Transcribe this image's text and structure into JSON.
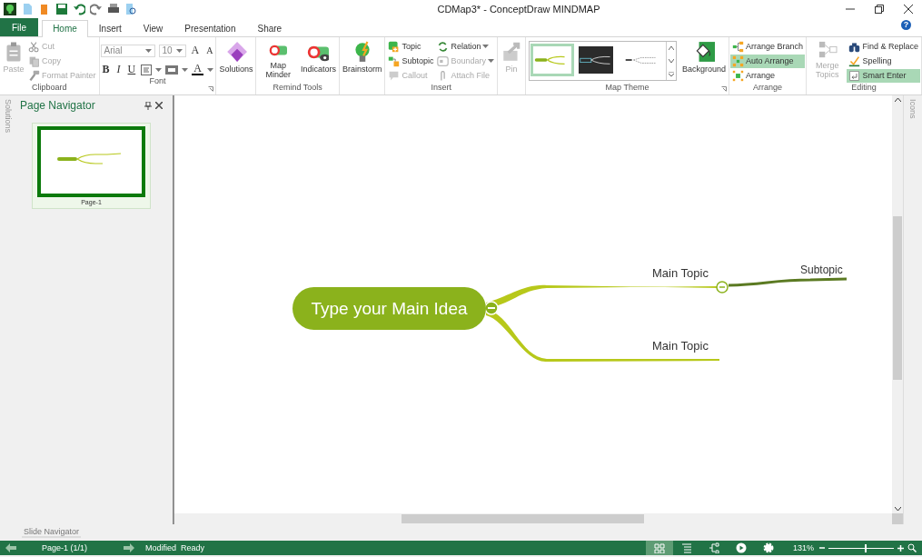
{
  "window": {
    "title": "CDMap3* - ConceptDraw MINDMAP",
    "help": "?"
  },
  "tabs": [
    {
      "label": "File",
      "kind": "file",
      "selected": false
    },
    {
      "label": "Home",
      "kind": "tab",
      "selected": true
    },
    {
      "label": "Insert",
      "kind": "tab",
      "selected": false
    },
    {
      "label": "View",
      "kind": "tab",
      "selected": false
    },
    {
      "label": "Presentation",
      "kind": "tab",
      "selected": false
    },
    {
      "label": "Share",
      "kind": "tab",
      "selected": false
    }
  ],
  "ribbon": {
    "groups": [
      {
        "kind": "buttons",
        "label": "Clipboard",
        "items": [
          {
            "kind": "large",
            "label": "Paste",
            "disabled": true
          },
          {
            "kind": "small",
            "label": "Cut",
            "disabled": true
          },
          {
            "kind": "small",
            "label": "Copy",
            "disabled": true
          },
          {
            "kind": "small",
            "label": "Format Painter",
            "disabled": true
          }
        ]
      },
      {
        "kind": "font",
        "label": "Font",
        "launcher": true,
        "font": {
          "value": "Arial"
        },
        "size": {
          "value": "10"
        },
        "grow": "A",
        "shrink": "A",
        "styles": [
          "B",
          "I",
          "U"
        ],
        "color_letter": "A"
      },
      {
        "kind": "buttons",
        "items": [
          {
            "kind": "large",
            "label": "Solutions",
            "disabled": false
          }
        ]
      },
      {
        "kind": "buttons",
        "label": "Remind Tools",
        "items": [
          {
            "kind": "large",
            "label": "Map Minder",
            "disabled": false
          },
          {
            "kind": "large",
            "label": "Indicators",
            "disabled": false
          }
        ]
      },
      {
        "kind": "buttons",
        "items": [
          {
            "kind": "large",
            "label": "Brainstorm",
            "disabled": false
          }
        ]
      },
      {
        "kind": "buttons",
        "label": "Insert",
        "items": [
          {
            "kind": "small",
            "label": "Topic",
            "disabled": false
          },
          {
            "kind": "small",
            "label": "Subtopic",
            "disabled": false
          },
          {
            "kind": "small",
            "label": "Callout",
            "disabled": true
          },
          {
            "kind": "small",
            "label": "Relation",
            "disabled": false,
            "dropdown": true
          },
          {
            "kind": "small",
            "label": "Boundary",
            "disabled": true,
            "dropdown": true
          },
          {
            "kind": "small",
            "label": "Attach File",
            "disabled": true
          }
        ]
      },
      {
        "kind": "buttons",
        "items": [
          {
            "kind": "large",
            "label": "Pin",
            "disabled": true
          }
        ]
      },
      {
        "kind": "gallery",
        "label": "Map Theme",
        "launcher": true,
        "themes": [
          {
            "kind": "light",
            "selected": true
          },
          {
            "kind": "dark",
            "selected": false
          },
          {
            "kind": "plain",
            "selected": false
          }
        ],
        "items": [
          {
            "kind": "large",
            "label": "Background",
            "disabled": false
          }
        ]
      },
      {
        "kind": "buttons",
        "label": "Arrange",
        "items": [
          {
            "kind": "small",
            "label": "Arrange Branch",
            "disabled": false,
            "on": false
          },
          {
            "kind": "small",
            "label": "Auto Arrange",
            "disabled": false,
            "on": true
          },
          {
            "kind": "small",
            "label": "Arrange",
            "disabled": false,
            "on": false
          }
        ]
      },
      {
        "kind": "buttons",
        "label": "Editing",
        "items": [
          {
            "kind": "large",
            "label": "Merge Topics",
            "disabled": true,
            "on": false
          },
          {
            "kind": "small",
            "label": "Find & Replace",
            "disabled": false,
            "on": false
          },
          {
            "kind": "small",
            "label": "Spelling",
            "disabled": false,
            "on": false
          },
          {
            "kind": "small",
            "label": "Smart Enter",
            "disabled": false,
            "on": true
          }
        ]
      }
    ]
  },
  "left_strip": {
    "label": "Solutions"
  },
  "page_navigator": {
    "title": "Page Navigator",
    "pages": [
      {
        "label": "Page-1",
        "selected": true
      }
    ]
  },
  "right_strip": {
    "label": "Icons"
  },
  "map": {
    "main_idea": {
      "label": "Type your Main Idea",
      "expanded": true
    },
    "topics": [
      {
        "label": "Main Topic",
        "expanded": true,
        "children": [
          {
            "label": "Subtopic"
          }
        ]
      },
      {
        "label": "Main Topic"
      }
    ]
  },
  "slide_navigator": {
    "label": "Slide Navigator"
  },
  "status_bar": {
    "page": "Page-1 (1/1)",
    "modified": "Modified",
    "state": "Ready",
    "view_modes": [
      {
        "selected": true
      },
      {
        "selected": false
      },
      {
        "selected": false
      },
      {
        "selected": false
      },
      {
        "selected": false
      }
    ],
    "zoom": {
      "reading": "131%",
      "level": 0.55
    }
  }
}
